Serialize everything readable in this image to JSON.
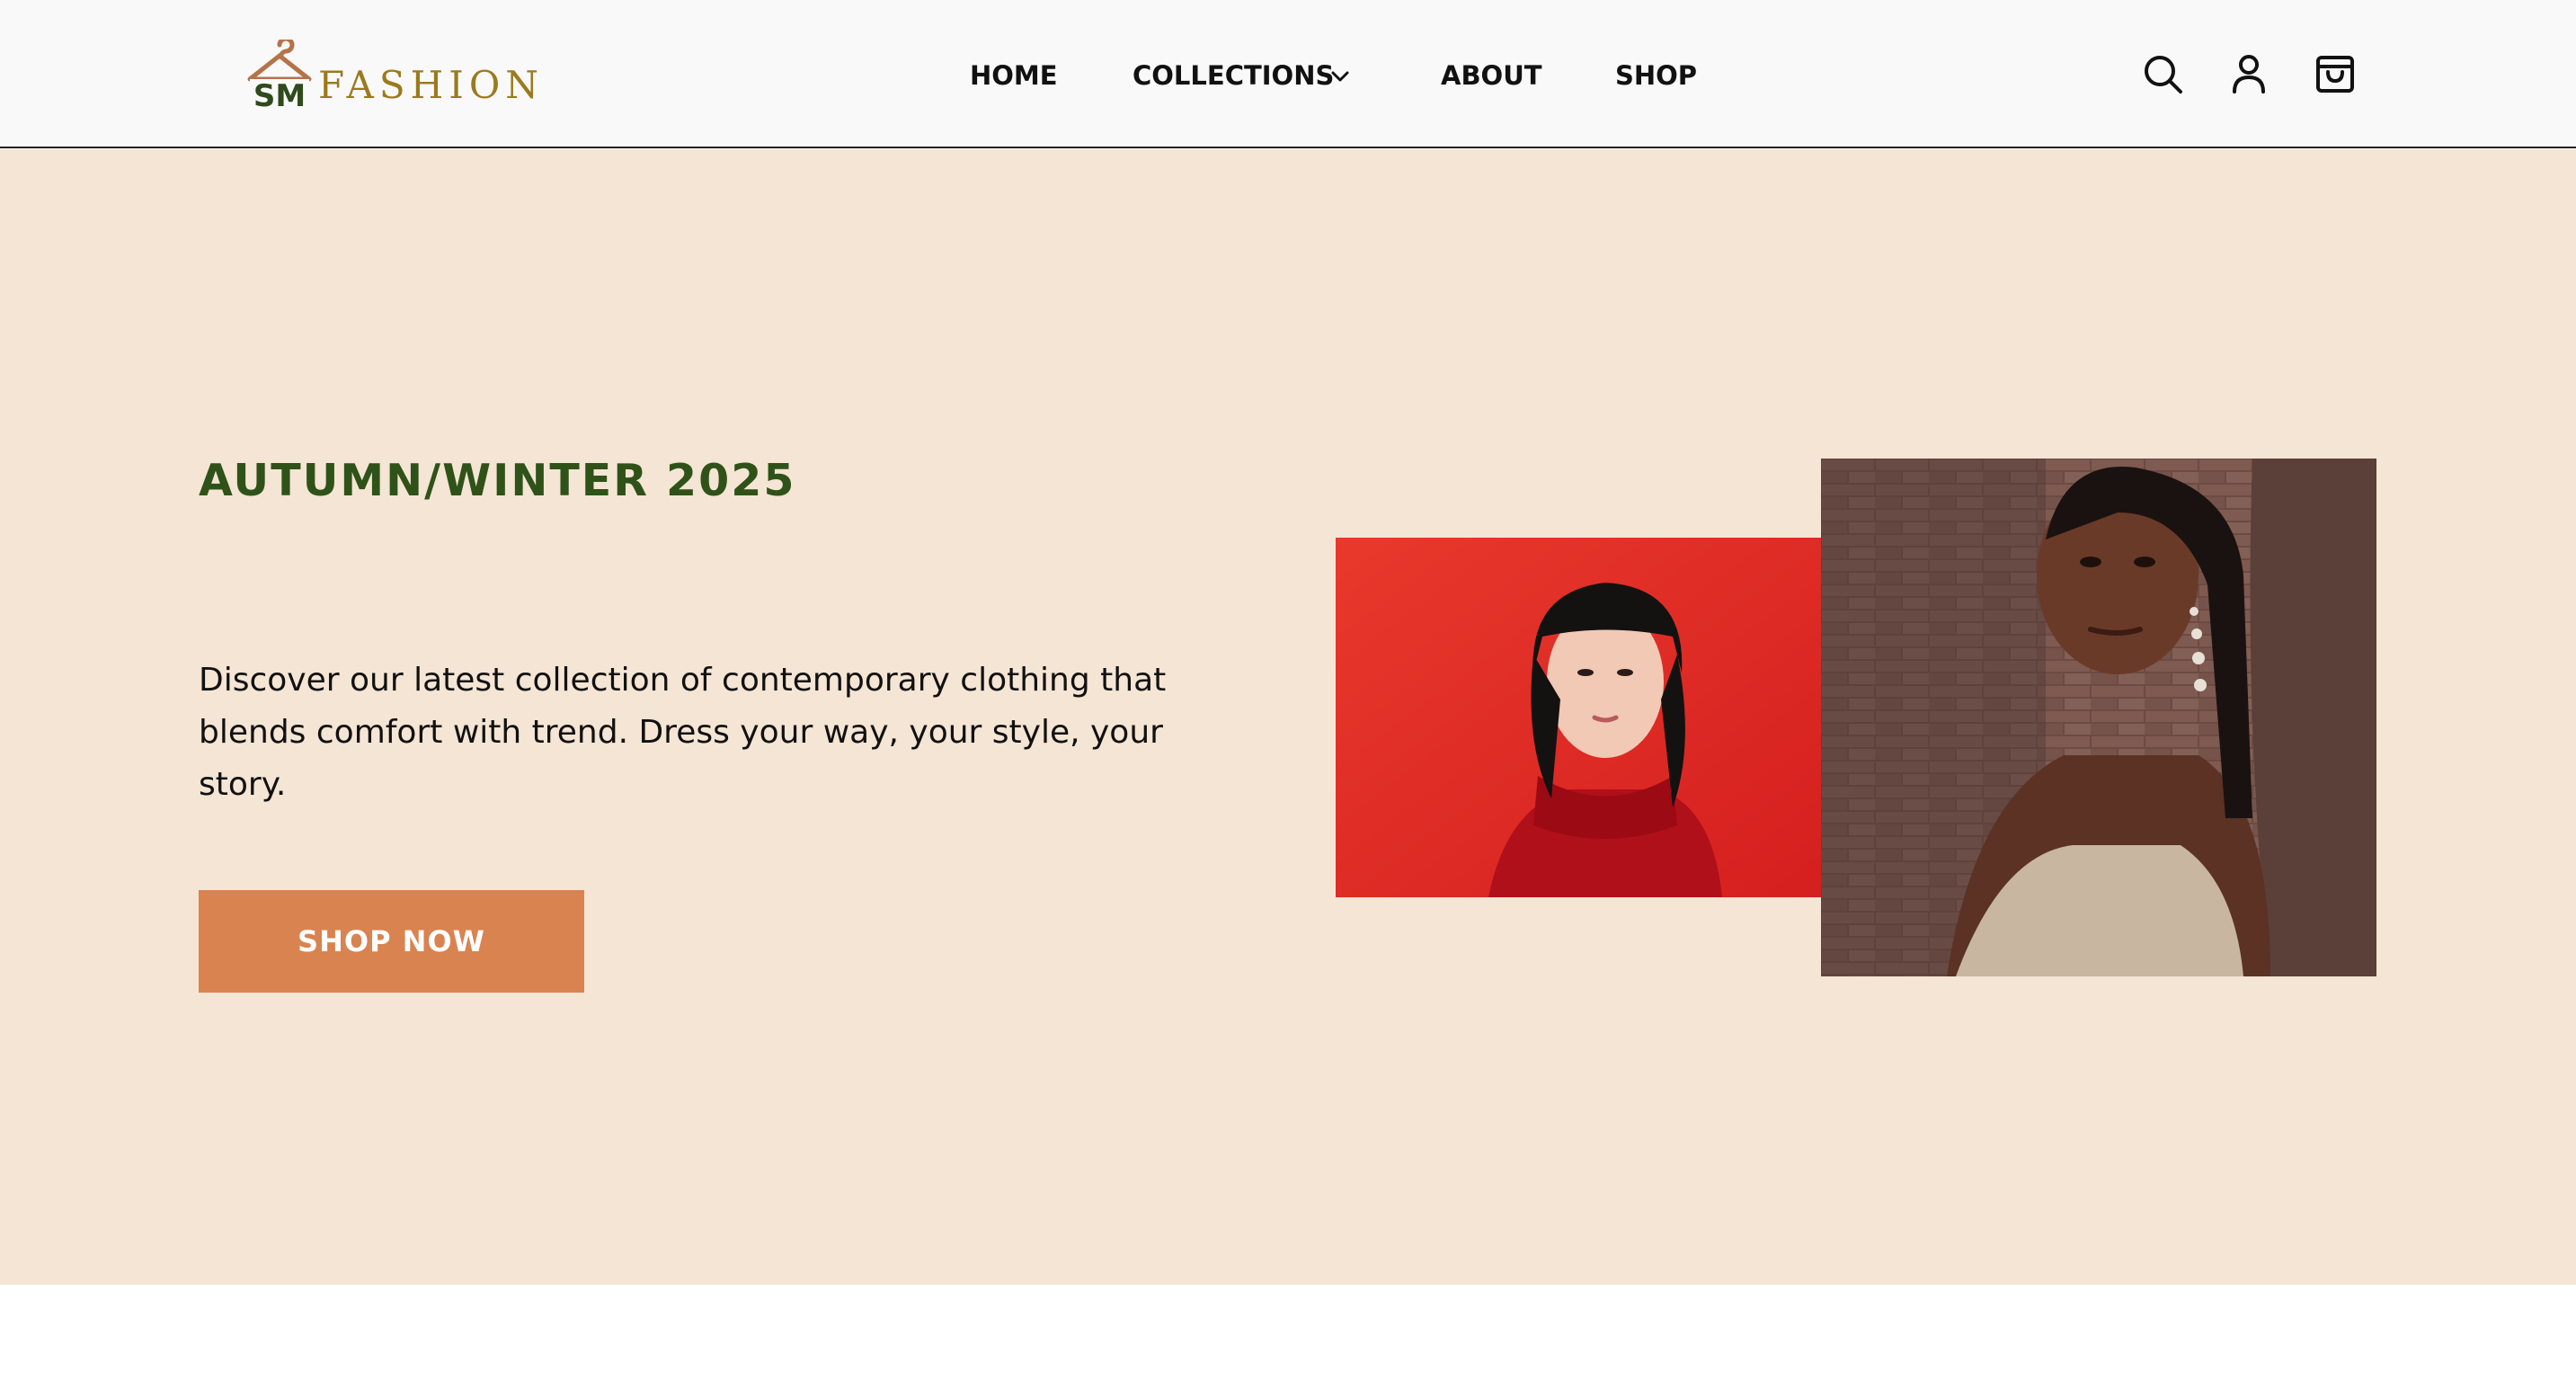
{
  "brand": {
    "monogram": "SM",
    "name": "FASHION"
  },
  "nav": {
    "items": [
      {
        "label": "HOME"
      },
      {
        "label": "COLLECTIONS",
        "has_dropdown": true
      },
      {
        "label": "ABOUT"
      },
      {
        "label": "SHOP"
      }
    ]
  },
  "header_icons": [
    "search-icon",
    "user-icon",
    "shopping-bag-icon"
  ],
  "hero": {
    "title": "AUTUMN/WINTER 2025",
    "description": "Discover our latest collection of contemporary clothing that blends comfort with trend. Dress your way, your style, your story.",
    "cta_label": "SHOP NOW",
    "images": [
      {
        "subject": "woman in red turtleneck against red wall"
      },
      {
        "subject": "woman in satin top against brick wall"
      }
    ]
  },
  "colors": {
    "hero_background": "#f5e5d4",
    "title_green": "#2f5218",
    "cta_orange": "#d98350",
    "brand_gold": "#9b7a1d",
    "header_background": "#f9f9f9"
  }
}
